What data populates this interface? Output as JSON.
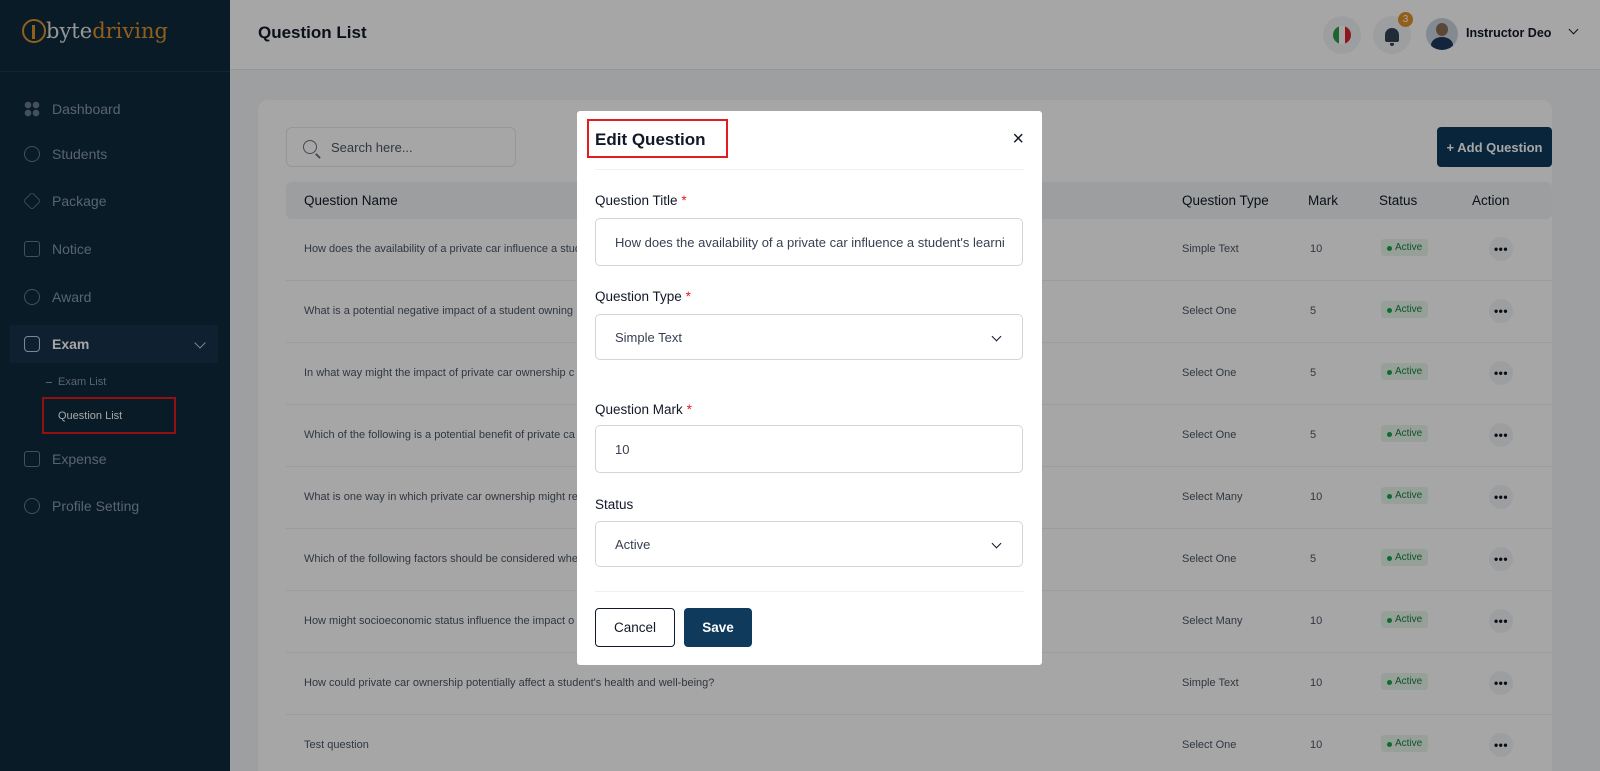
{
  "sidebar": {
    "logo_byte": "byte",
    "logo_driving": "driving",
    "items": [
      {
        "label": "Dashboard",
        "icon": "dashboard-icon"
      },
      {
        "label": "Students",
        "icon": "users-icon"
      },
      {
        "label": "Package",
        "icon": "layers-icon"
      },
      {
        "label": "Notice",
        "icon": "notice-icon"
      },
      {
        "label": "Award",
        "icon": "award-icon"
      },
      {
        "label": "Exam",
        "icon": "exam-icon"
      },
      {
        "label": "Expense",
        "icon": "wallet-icon"
      },
      {
        "label": "Profile Setting",
        "icon": "gear-icon"
      }
    ],
    "exam_sub": [
      {
        "label": "Exam List"
      },
      {
        "label": "Question List"
      }
    ]
  },
  "header": {
    "title": "Question List",
    "notification_count": "3",
    "user_name": "Instructor Deo"
  },
  "toolbar": {
    "search_placeholder": "Search here...",
    "add_button": "+ Add Question"
  },
  "table": {
    "columns": [
      "Question Name",
      "Question Type",
      "Mark",
      "Status",
      "Action"
    ],
    "rows": [
      {
        "name": "How does the availability of a private car influence a stud",
        "type": "Simple Text",
        "mark": "10",
        "status": "Active"
      },
      {
        "name": "What is a potential negative impact of a student owning",
        "type": "Select One",
        "mark": "5",
        "status": "Active"
      },
      {
        "name": "In what way might the impact of private car ownership c",
        "type": "Select One",
        "mark": "5",
        "status": "Active"
      },
      {
        "name": "Which of the following is a potential benefit of private ca",
        "type": "Select One",
        "mark": "5",
        "status": "Active"
      },
      {
        "name": "What is one way in which private car ownership might re",
        "type": "Select Many",
        "mark": "10",
        "status": "Active"
      },
      {
        "name": "Which of the following factors should be considered whe",
        "type": "Select One",
        "mark": "5",
        "status": "Active"
      },
      {
        "name": "How might socioeconomic status influence the impact o",
        "type": "Select Many",
        "mark": "10",
        "status": "Active"
      },
      {
        "name": "How could private car ownership potentially affect a student's health and well-being?",
        "type": "Simple Text",
        "mark": "10",
        "status": "Active"
      },
      {
        "name": "Test question",
        "type": "Select One",
        "mark": "10",
        "status": "Active"
      }
    ]
  },
  "modal": {
    "title": "Edit Question",
    "close": "×",
    "title_label": "Question Title",
    "title_value": "How does the availability of a private car influence a student's learning",
    "type_label": "Question Type",
    "type_value": "Simple Text",
    "mark_label": "Question Mark",
    "mark_value": "10",
    "status_label": "Status",
    "status_value": "Active",
    "required_mark": "*",
    "cancel": "Cancel",
    "save": "Save"
  },
  "colors": {
    "sidebar_bg": "#0f2a3d",
    "brand_orange": "#e0922a",
    "primary": "#0f3a5c",
    "highlight_red": "#e11d1d",
    "active_green": "#16a34a"
  }
}
